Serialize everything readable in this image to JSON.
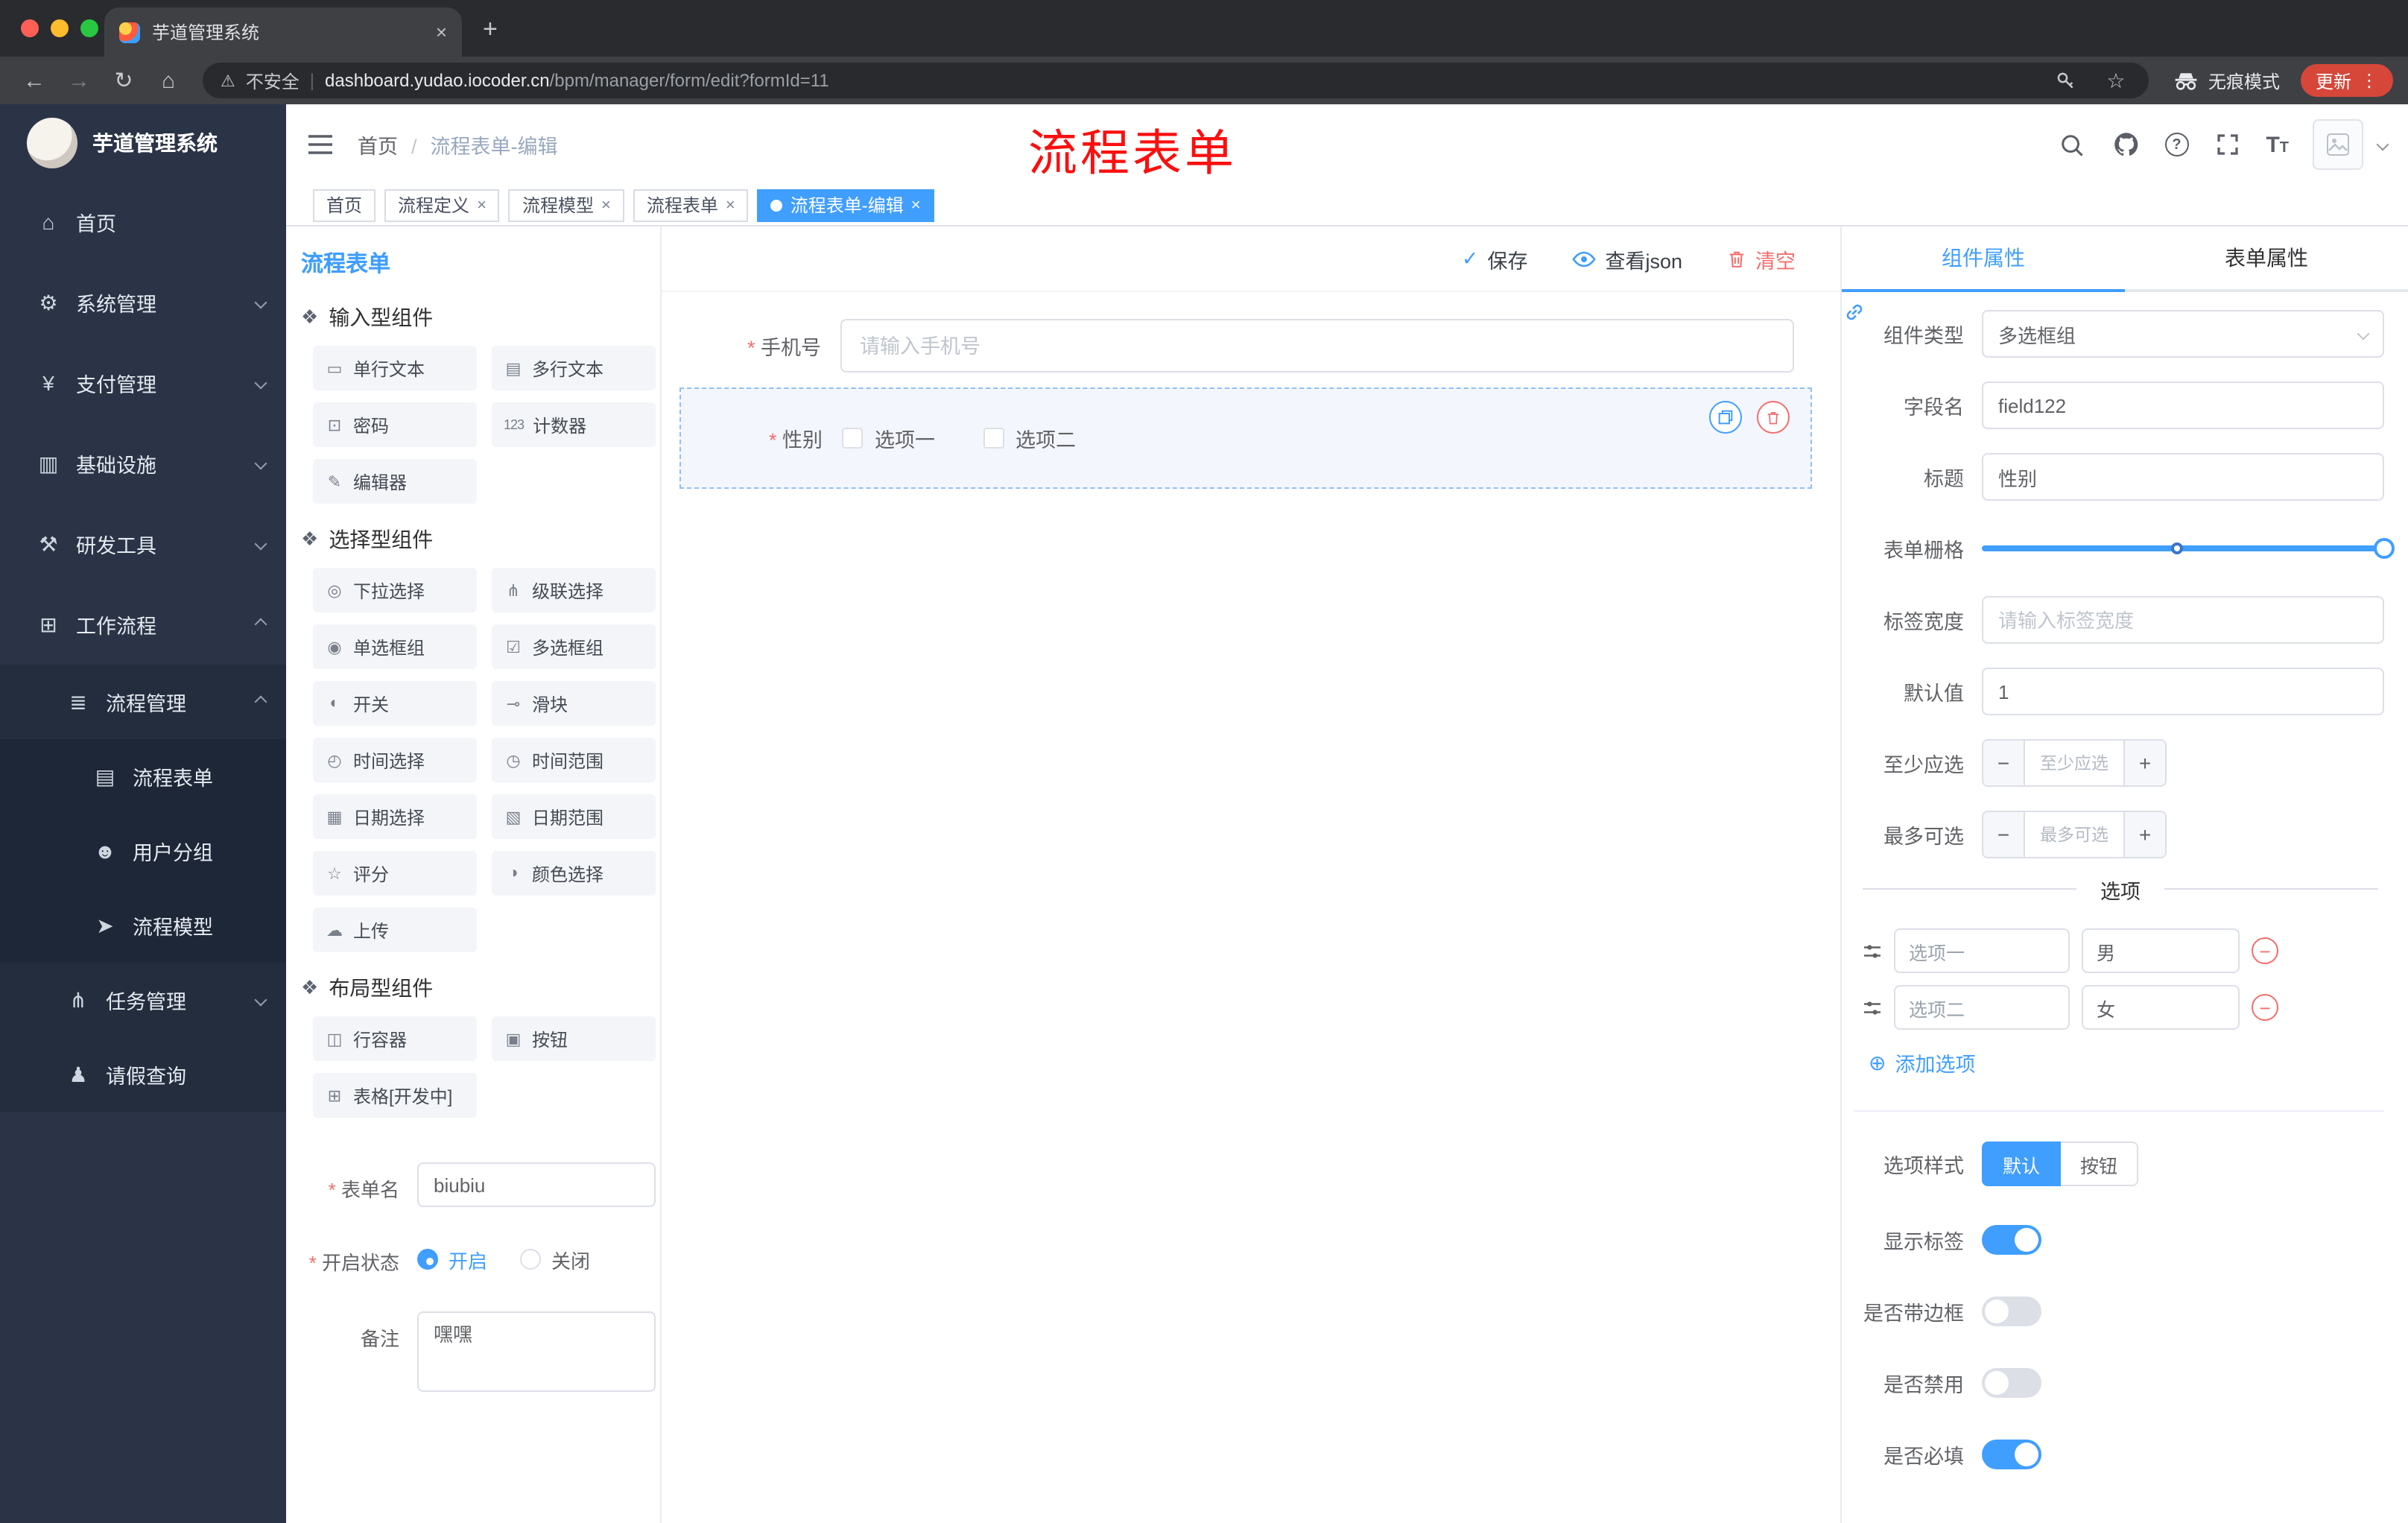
{
  "browser": {
    "tab_title": "芋道管理系统",
    "security_label": "不安全",
    "url_host": "dashboard.yudao.iocoder.cn",
    "url_path": "/bpm/manager/form/edit?formId=11",
    "incognito_label": "无痕模式",
    "update_label": "更新"
  },
  "sidebar": {
    "brand": "芋道管理系统",
    "items": [
      {
        "icon": "⌂",
        "label": "首页"
      },
      {
        "icon": "⚙",
        "label": "系统管理"
      },
      {
        "icon": "¥",
        "label": "支付管理"
      },
      {
        "icon": "▥",
        "label": "基础设施"
      },
      {
        "icon": "⚒",
        "label": "研发工具"
      },
      {
        "icon": "⊞",
        "label": "工作流程"
      },
      {
        "icon": "≣",
        "label": "流程管理"
      },
      {
        "icon": "▤",
        "label": "流程表单"
      },
      {
        "icon": "☻",
        "label": "用户分组"
      },
      {
        "icon": "➤",
        "label": "流程模型"
      },
      {
        "icon": "⋔",
        "label": "任务管理"
      },
      {
        "icon": "♟",
        "label": "请假查询"
      }
    ]
  },
  "header": {
    "breadcrumb_home": "首页",
    "breadcrumb_current": "流程表单-编辑",
    "annotation": "流程表单"
  },
  "tags": [
    {
      "label": "首页",
      "closable": false,
      "active": false
    },
    {
      "label": "流程定义",
      "closable": true,
      "active": false
    },
    {
      "label": "流程模型",
      "closable": true,
      "active": false
    },
    {
      "label": "流程表单",
      "closable": true,
      "active": false
    },
    {
      "label": "流程表单-编辑",
      "closable": true,
      "active": true
    }
  ],
  "designer": {
    "panel_title": "流程表单",
    "toolbar": {
      "save": "保存",
      "view_json": "查看json",
      "clear": "清空"
    },
    "palette": {
      "groups": [
        {
          "title": "输入型组件",
          "items": [
            {
              "icon": "▭",
              "label": "单行文本"
            },
            {
              "icon": "▤",
              "label": "多行文本"
            },
            {
              "icon": "⊡",
              "label": "密码"
            },
            {
              "icon": "123",
              "label": "计数器"
            },
            {
              "icon": "✎",
              "label": "编辑器"
            }
          ]
        },
        {
          "title": "选择型组件",
          "items": [
            {
              "icon": "◎",
              "label": "下拉选择"
            },
            {
              "icon": "⋔",
              "label": "级联选择"
            },
            {
              "icon": "◉",
              "label": "单选框组"
            },
            {
              "icon": "☑",
              "label": "多选框组"
            },
            {
              "icon": "◐",
              "label": "开关"
            },
            {
              "icon": "⊸",
              "label": "滑块"
            },
            {
              "icon": "◴",
              "label": "时间选择"
            },
            {
              "icon": "◷",
              "label": "时间范围"
            },
            {
              "icon": "▦",
              "label": "日期选择"
            },
            {
              "icon": "▧",
              "label": "日期范围"
            },
            {
              "icon": "☆",
              "label": "评分"
            },
            {
              "icon": "◑",
              "label": "颜色选择"
            },
            {
              "icon": "☁",
              "label": "上传"
            }
          ]
        },
        {
          "title": "布局型组件",
          "items": [
            {
              "icon": "◫",
              "label": "行容器"
            },
            {
              "icon": "▣",
              "label": "按钮"
            },
            {
              "icon": "⊞",
              "label": "表格[开发中]"
            }
          ]
        }
      ]
    },
    "meta": {
      "name_label": "表单名",
      "name_value": "biubiu",
      "status_label": "开启状态",
      "status_on": "开启",
      "status_off": "关闭",
      "remark_label": "备注",
      "remark_value": "嘿嘿"
    },
    "canvas": {
      "phone_label": "手机号",
      "phone_placeholder": "请输入手机号",
      "gender_label": "性别",
      "gender_opt1": "选项一",
      "gender_opt2": "选项二"
    },
    "props": {
      "tab_component": "组件属性",
      "tab_form": "表单属性",
      "type_label": "组件类型",
      "type_value": "多选框组",
      "field_label": "字段名",
      "field_value": "field122",
      "title_label": "标题",
      "title_value": "性别",
      "grid_label": "表单栅格",
      "width_label": "标签宽度",
      "width_placeholder": "请输入标签宽度",
      "default_label": "默认值",
      "default_value": "1",
      "min_label": "至少应选",
      "min_placeholder": "至少应选",
      "max_label": "最多可选",
      "max_placeholder": "最多可选",
      "options_title": "选项",
      "options": [
        {
          "label": "选项一",
          "value": "男"
        },
        {
          "label": "选项二",
          "value": "女"
        }
      ],
      "add_option": "添加选项",
      "style_label": "选项样式",
      "style_default": "默认",
      "style_button": "按钮",
      "switches": [
        {
          "label": "显示标签",
          "on": true
        },
        {
          "label": "是否带边框",
          "on": false
        },
        {
          "label": "是否禁用",
          "on": false
        },
        {
          "label": "是否必填",
          "on": true
        }
      ]
    }
  }
}
